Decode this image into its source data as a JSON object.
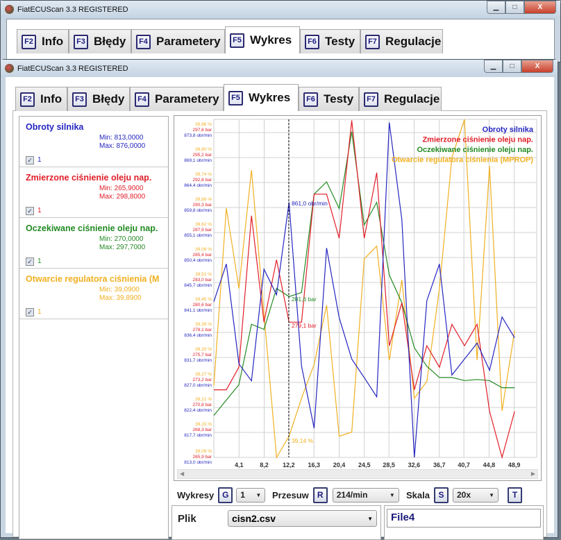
{
  "app_title": "FiatECUScan 3.3 REGISTERED",
  "window_buttons": {
    "minimize": "▁",
    "maximize": "□",
    "close": "X"
  },
  "tabs": [
    {
      "key": "F2",
      "label": "Info"
    },
    {
      "key": "F3",
      "label": "Błędy"
    },
    {
      "key": "F4",
      "label": "Parametery"
    },
    {
      "key": "F5",
      "label": "Wykres",
      "selected": true
    },
    {
      "key": "F6",
      "label": "Testy"
    },
    {
      "key": "F7",
      "label": "Regulacje"
    }
  ],
  "signals": [
    {
      "name": "Obroty silnika",
      "min": "Min: 813,0000",
      "max": "Max: 876,0000",
      "checkbox_label": "1",
      "checked": true,
      "color": "#2525c0"
    },
    {
      "name": "Zmierzone ciśnienie oleju nap.",
      "min": "Min: 265,9000",
      "max": "Max: 298,8000",
      "checkbox_label": "1",
      "checked": true,
      "color": "#e01e28"
    },
    {
      "name": "Oczekiwane ciśnienie oleju nap.",
      "min": "Min: 270,0000",
      "max": "Max: 297,7000",
      "checkbox_label": "1",
      "checked": true,
      "color": "#238a23"
    },
    {
      "name": "Otwarcie regulatora ciśnienia (MPROP)",
      "name_visible": "Otwarcie regulatora ciśnienia (M",
      "min": "Min: 39,0900",
      "max": "Max: 39,8900",
      "checkbox_label": "1",
      "checked": true,
      "color": "#f0b020"
    }
  ],
  "chart_data": {
    "type": "line",
    "x_ticks": [
      "4,1",
      "8,2",
      "12,2",
      "16,3",
      "20,4",
      "24,5",
      "28,5",
      "32,6",
      "36,7",
      "40,7",
      "44,8",
      "48,9"
    ],
    "x_tick_values": [
      4.1,
      8.2,
      12.2,
      16.3,
      20.4,
      24.5,
      28.5,
      32.6,
      36.7,
      40.7,
      44.8,
      48.9
    ],
    "x": [
      0,
      2.04,
      4.08,
      6.12,
      8.16,
      10.2,
      12.24,
      14.28,
      16.32,
      18.36,
      20.4,
      22.44,
      24.48,
      26.52,
      28.56,
      30.6,
      32.64,
      34.68,
      36.72,
      38.76,
      40.8,
      42.84,
      44.88,
      46.92,
      48.96
    ],
    "xlim": [
      0,
      52.7
    ],
    "grid": true,
    "legend_position": "top-right",
    "y_tick_labels": {
      "pct": [
        "39,86 %",
        "39,80 %",
        "39,74 %",
        "39,68 %",
        "39,62 %",
        "39,56 %",
        "39,51 %",
        "39,45 %",
        "39,39 %",
        "39,33 %",
        "39,27 %",
        "39,21 %",
        "39,15 %",
        "39,09 %"
      ],
      "bar": [
        "297,6 bar",
        "295,2 bar",
        "292,8 bar",
        "290,3 bar",
        "287,9 bar",
        "285,4 bar",
        "283,0 bar",
        "280,6 bar",
        "278,1 bar",
        "275,7 bar",
        "273,2 bar",
        "270,8 bar",
        "268,3 bar",
        "265,9 bar"
      ],
      "rpm": [
        "873,8 obr/min",
        "869,1 obr/min",
        "864,4 obr/min",
        "859,8 obr/min",
        "855,1 obr/min",
        "850,4 obr/min",
        "845,7 obr/min",
        "841,1 obr/min",
        "836,4 obr/min",
        "831,7 obr/min",
        "827,0 obr/min",
        "822,4 obr/min",
        "817,7 obr/min",
        "813,0 obr/min"
      ]
    },
    "series": [
      {
        "name": "Obroty silnika",
        "color": "#2525c0",
        "ylim": [
          813.0,
          876.6
        ],
        "values": [
          842.3,
          849.4,
          830.6,
          827.4,
          848.4,
          843.6,
          861.0,
          830.2,
          818.5,
          852.4,
          839.3,
          831.5,
          828.0,
          824.4,
          876.0,
          857.7,
          813.0,
          842.5,
          849.4,
          828.5,
          831.5,
          834.5,
          829.4,
          839.4,
          835.5
        ]
      },
      {
        "name": "Zmierzone ciśnienie oleju nap.",
        "color": "#e01e28",
        "ylim": [
          265.9,
          298.9
        ],
        "values": [
          272.5,
          272.5,
          274.7,
          289.5,
          279.1,
          285.2,
          279.1,
          279.1,
          291.6,
          291.6,
          287.3,
          298.8,
          287.3,
          293.7,
          276.8,
          281.0,
          272.5,
          276.8,
          274.7,
          278.9,
          276.8,
          278.9,
          270.4,
          265.9,
          270.4
        ]
      },
      {
        "name": "Oczekiwane ciśnienie oleju nap.",
        "color": "#238a23",
        "ylim": [
          265.9,
          298.9
        ],
        "values": [
          270.0,
          271.5,
          273.0,
          278.9,
          278.4,
          282.4,
          281.6,
          282.0,
          291.6,
          292.8,
          290.2,
          297.7,
          288.6,
          290.8,
          283.7,
          281.0,
          276.6,
          274.8,
          273.7,
          273.7,
          273.4,
          273.5,
          273.4,
          272.7,
          272.7
        ]
      },
      {
        "name": "Otwarcie regulatora ciśnienia (MPROP)",
        "color": "#f0b020",
        "ylim": [
          39.09,
          39.89
        ],
        "values": [
          39.26,
          39.68,
          39.49,
          39.77,
          39.43,
          39.09,
          39.14,
          39.23,
          39.31,
          39.45,
          39.14,
          39.15,
          39.56,
          39.59,
          39.32,
          39.51,
          39.23,
          39.27,
          39.49,
          39.8,
          39.89,
          39.32,
          39.78,
          39.2,
          39.39
        ]
      }
    ],
    "cursor": {
      "x": 12.2,
      "labels": [
        {
          "text": "861,0 obr/min",
          "series": 0
        },
        {
          "text": "281,6 bar",
          "series": 2
        },
        {
          "text": "279,1 bar",
          "series": 1
        },
        {
          "text": "39,14 %",
          "series": 3
        }
      ]
    }
  },
  "controls": {
    "wykresy_label": "Wykresy",
    "wykresy_key": "G",
    "wykresy_value": "1",
    "przesuw_label": "Przesuw",
    "przesuw_key": "R",
    "przesuw_value": "214/min",
    "skala_label": "Skala",
    "skala_key": "S",
    "skala_value": "20x",
    "t_key": "T"
  },
  "file": {
    "label": "Plik",
    "value": "cisn2.csv",
    "name": "File4"
  }
}
